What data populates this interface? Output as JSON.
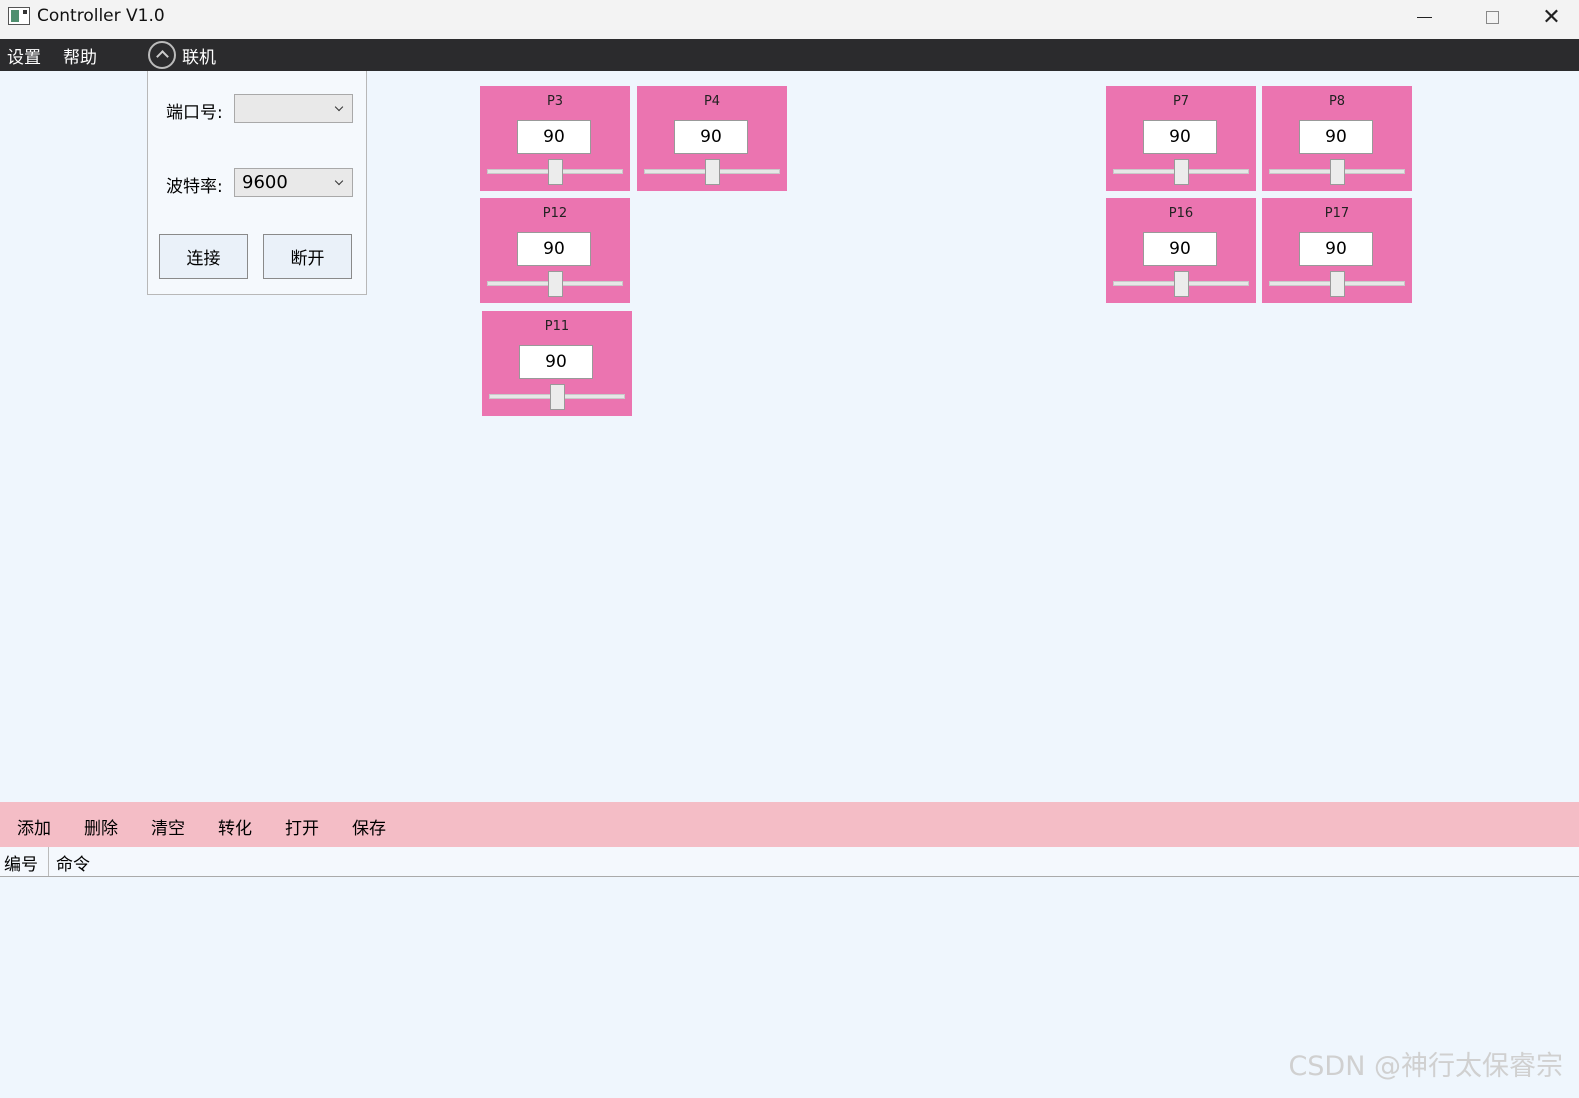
{
  "window": {
    "title": "Controller V1.0",
    "close_glyph": "✕"
  },
  "menu": {
    "settings": "设置",
    "help": "帮助",
    "connect": "联机"
  },
  "connection_panel": {
    "port_label": "端口号:",
    "port_value": "",
    "baud_label": "波特率:",
    "baud_value": "9600",
    "connect_button": "连接",
    "disconnect_button": "断开"
  },
  "servos": [
    {
      "name": "P3",
      "value": "90",
      "level": 0.5
    },
    {
      "name": "P4",
      "value": "90",
      "level": 0.5
    },
    {
      "name": "P7",
      "value": "90",
      "level": 0.5
    },
    {
      "name": "P8",
      "value": "90",
      "level": 0.5
    },
    {
      "name": "P12",
      "value": "90",
      "level": 0.5
    },
    {
      "name": "P16",
      "value": "90",
      "level": 0.5
    },
    {
      "name": "P17",
      "value": "90",
      "level": 0.5
    },
    {
      "name": "P11",
      "value": "90",
      "level": 0.5
    }
  ],
  "toolbar": {
    "add": "添加",
    "delete": "删除",
    "clear": "清空",
    "convert": "转化",
    "open": "打开",
    "save": "保存"
  },
  "table": {
    "col_id": "编号",
    "col_command": "命令"
  },
  "watermark": "CSDN @神行太保睿宗",
  "colors": {
    "servo_card": "#eb74b0",
    "menubar": "#2b2b2d",
    "toolbar": "#f4bdc6",
    "background": "#eff6fd"
  }
}
